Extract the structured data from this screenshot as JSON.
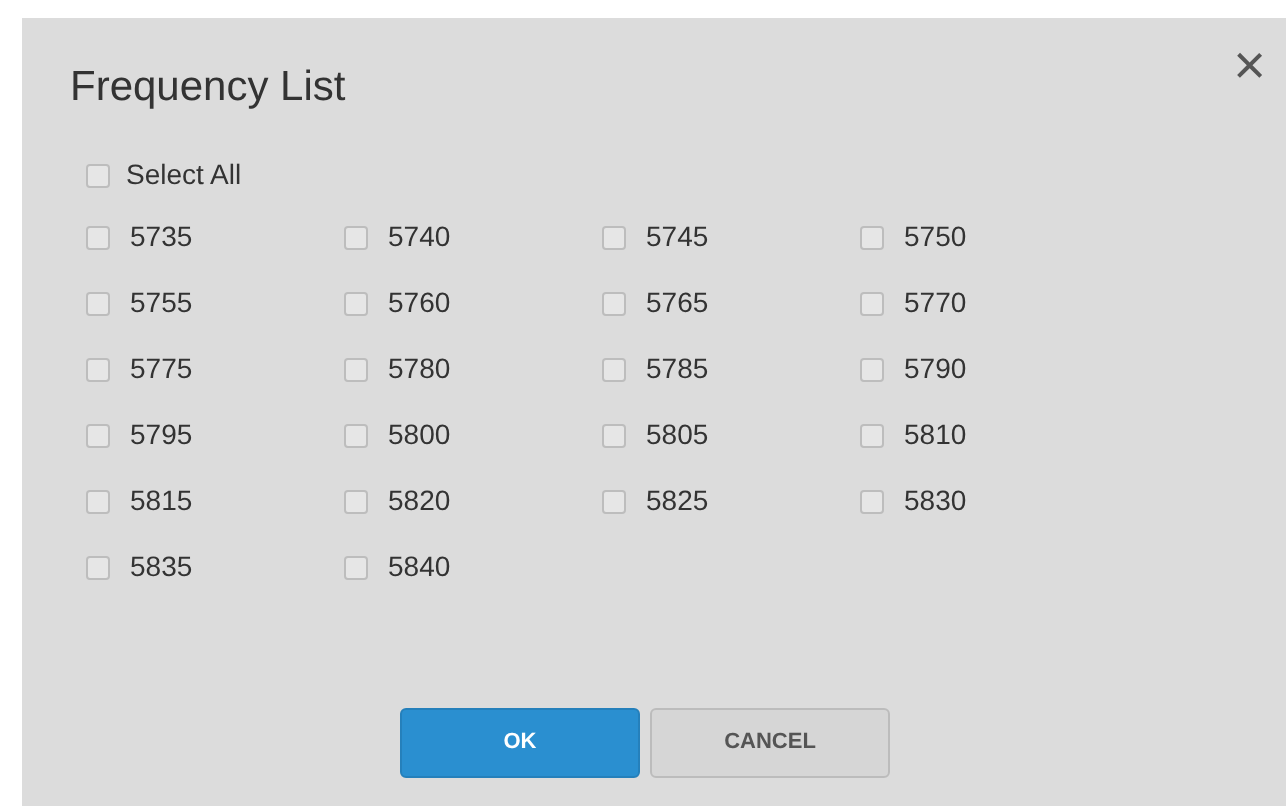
{
  "dialog": {
    "title": "Frequency List",
    "close": "×"
  },
  "select_all": {
    "label": "Select All",
    "checked": false
  },
  "frequencies": [
    {
      "label": "5735",
      "checked": false
    },
    {
      "label": "5740",
      "checked": false
    },
    {
      "label": "5745",
      "checked": false
    },
    {
      "label": "5750",
      "checked": false
    },
    {
      "label": "5755",
      "checked": false
    },
    {
      "label": "5760",
      "checked": false
    },
    {
      "label": "5765",
      "checked": false
    },
    {
      "label": "5770",
      "checked": false
    },
    {
      "label": "5775",
      "checked": false
    },
    {
      "label": "5780",
      "checked": false
    },
    {
      "label": "5785",
      "checked": false
    },
    {
      "label": "5790",
      "checked": false
    },
    {
      "label": "5795",
      "checked": false
    },
    {
      "label": "5800",
      "checked": false
    },
    {
      "label": "5805",
      "checked": false
    },
    {
      "label": "5810",
      "checked": false
    },
    {
      "label": "5815",
      "checked": false
    },
    {
      "label": "5820",
      "checked": false
    },
    {
      "label": "5825",
      "checked": false
    },
    {
      "label": "5830",
      "checked": false
    },
    {
      "label": "5835",
      "checked": false
    },
    {
      "label": "5840",
      "checked": false
    }
  ],
  "buttons": [
    {
      "label": "OK",
      "kind": "primary"
    },
    {
      "label": "CANCEL",
      "kind": "secondary"
    }
  ]
}
